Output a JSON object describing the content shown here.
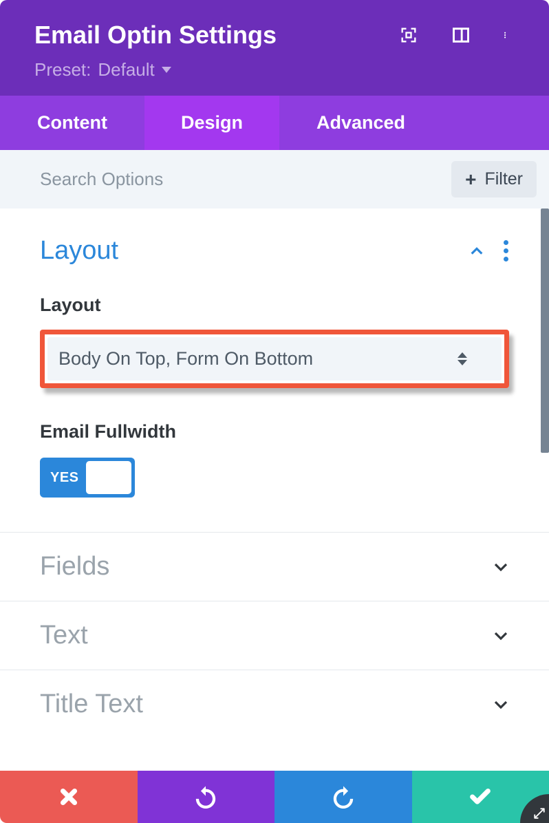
{
  "header": {
    "title": "Email Optin Settings",
    "preset_prefix": "Preset:",
    "preset_name": "Default"
  },
  "tabs": {
    "content": "Content",
    "design": "Design",
    "advanced": "Advanced"
  },
  "search": {
    "placeholder": "Search Options",
    "filter_label": "Filter"
  },
  "layout_section": {
    "title": "Layout",
    "layout_label": "Layout",
    "layout_value": "Body On Top, Form On Bottom",
    "fullwidth_label": "Email Fullwidth",
    "fullwidth_value": "YES"
  },
  "collapsed_sections": [
    "Fields",
    "Text",
    "Title Text"
  ]
}
